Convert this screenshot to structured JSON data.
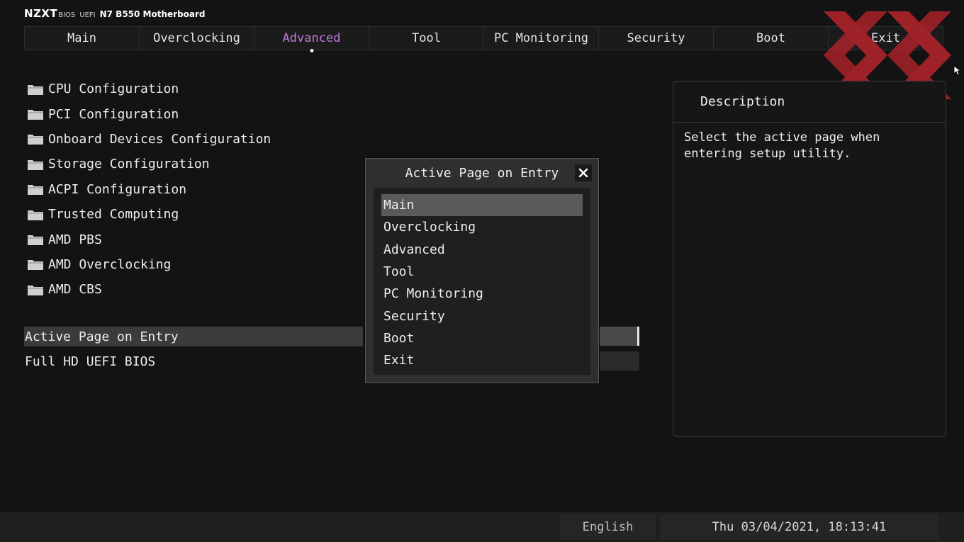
{
  "brand": {
    "logo": "NZXT",
    "bios_label": "BIOS",
    "uefi_label": "UEFI",
    "model": "N7 B550 Motherboard"
  },
  "tabs": [
    {
      "label": "Main"
    },
    {
      "label": "Overclocking"
    },
    {
      "label": "Advanced",
      "active": true
    },
    {
      "label": "Tool"
    },
    {
      "label": "PC Monitoring"
    },
    {
      "label": "Security"
    },
    {
      "label": "Boot"
    },
    {
      "label": "Exit"
    }
  ],
  "submenus": [
    {
      "label": "CPU Configuration"
    },
    {
      "label": "PCI Configuration"
    },
    {
      "label": "Onboard Devices Configuration"
    },
    {
      "label": "Storage Configuration"
    },
    {
      "label": "ACPI Configuration"
    },
    {
      "label": "Trusted Computing"
    },
    {
      "label": "AMD PBS"
    },
    {
      "label": "AMD Overclocking"
    },
    {
      "label": "AMD CBS"
    }
  ],
  "settings": [
    {
      "label": "Active Page on Entry",
      "selected": true
    },
    {
      "label": "Full HD UEFI BIOS"
    }
  ],
  "description": {
    "heading": "Description",
    "text": "Select the active page when entering setup utility."
  },
  "popup": {
    "title": "Active Page on Entry",
    "close_glyph": "✕",
    "options": [
      "Main",
      "Overclocking",
      "Advanced",
      "Tool",
      "PC Monitoring",
      "Security",
      "Boot",
      "Exit"
    ],
    "selected": "Main"
  },
  "status": {
    "language": "English",
    "datetime": "Thu 03/04/2021, 18:13:41"
  },
  "colors": {
    "background": "#131313",
    "active_tab": "#c07bd8",
    "selection": "#5a5a5a",
    "watermark": "#b3232b"
  }
}
